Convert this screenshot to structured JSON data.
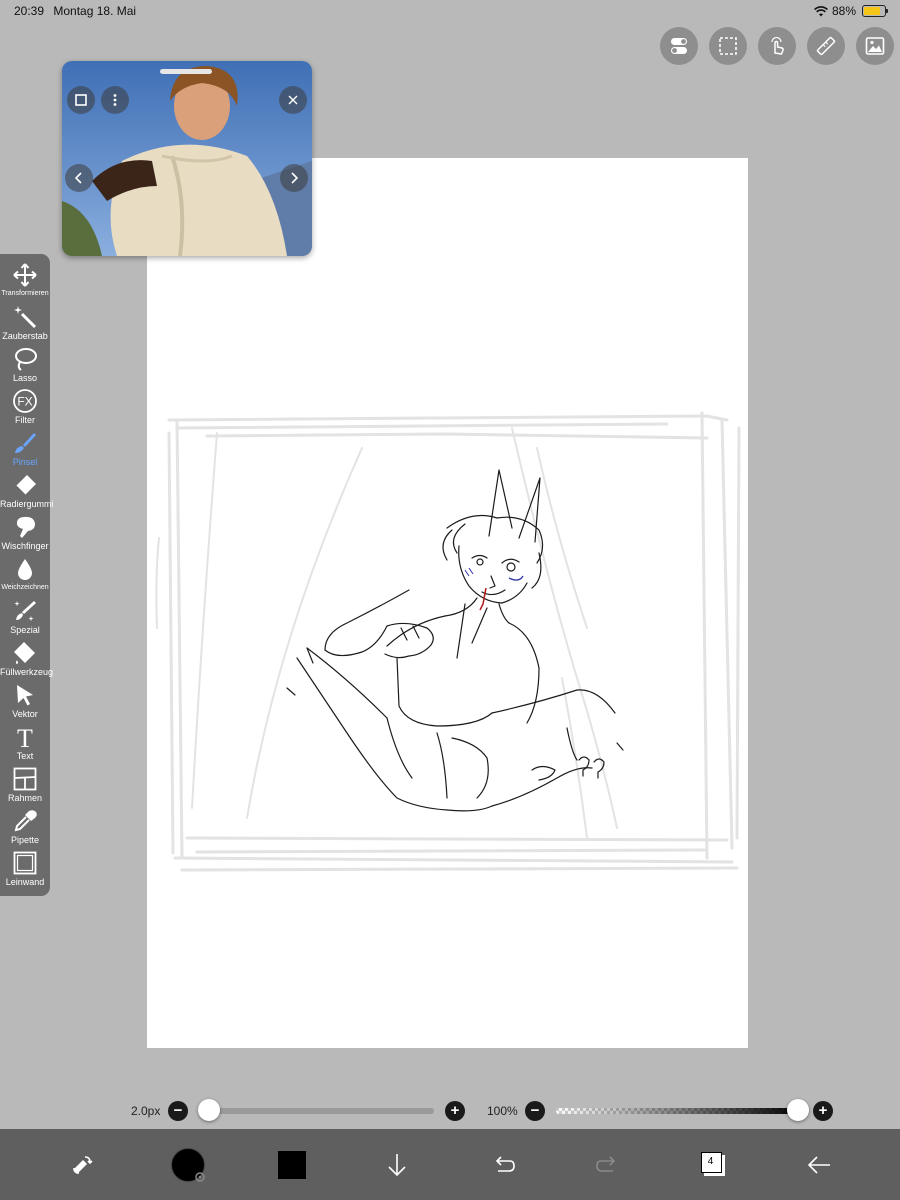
{
  "status_bar": {
    "time": "20:39",
    "date": "Montag 18. Mai",
    "battery": "88%",
    "battery_level": 0.88
  },
  "top_tools": [
    {
      "name": "settings-toggle-icon"
    },
    {
      "name": "selection-icon"
    },
    {
      "name": "gesture-icon"
    },
    {
      "name": "ruler-icon"
    },
    {
      "name": "gallery-icon"
    }
  ],
  "reference_window": {
    "icons": [
      "square-icon",
      "more-icon",
      "close-icon",
      "prev-arrow-icon",
      "next-arrow-icon"
    ]
  },
  "toolbar": {
    "items": [
      {
        "label": "Transformieren",
        "icon": "move-icon"
      },
      {
        "label": "Zauberstab",
        "icon": "magic-wand-icon"
      },
      {
        "label": "Lasso",
        "icon": "lasso-icon"
      },
      {
        "label": "Filter",
        "icon": "fx-icon",
        "glyph": "FX"
      },
      {
        "label": "Pinsel",
        "icon": "brush-icon",
        "active": true
      },
      {
        "label": "Radiergummi",
        "icon": "eraser-icon"
      },
      {
        "label": "Wischfinger",
        "icon": "smudge-icon"
      },
      {
        "label": "Weichzeichnen",
        "icon": "blur-drop-icon"
      },
      {
        "label": "Spezial",
        "icon": "special-brush-icon"
      },
      {
        "label": "Füllwerkzeug",
        "icon": "fill-bucket-icon"
      },
      {
        "label": "Vektor",
        "icon": "vector-arrow-icon"
      },
      {
        "label": "Text",
        "icon": "text-icon",
        "glyph": "T"
      },
      {
        "label": "Rahmen",
        "icon": "frame-icon"
      },
      {
        "label": "Pipette",
        "icon": "eyedropper-icon"
      },
      {
        "label": "Leinwand",
        "icon": "canvas-icon"
      }
    ]
  },
  "brush_size": {
    "value": "2.0px",
    "minus": "−",
    "plus": "+",
    "level": 0.0
  },
  "opacity": {
    "value": "100%",
    "minus": "−",
    "plus": "+",
    "level": 1.0
  },
  "bottom_bar": {
    "items": [
      "swap-tool-icon",
      "brush-settings",
      "color-swatch",
      "import-down-icon",
      "undo-icon",
      "redo-icon",
      "layers-icon",
      "back-arrow-icon"
    ],
    "layers_count": "4",
    "primary_color": "#000000"
  },
  "colors": {
    "background": "#b9b9b9",
    "toolbar": "#6b6b6b",
    "accent": "#6aa6ff",
    "bottom_bar": "#5f5f5f",
    "battery": "#f5c518"
  }
}
